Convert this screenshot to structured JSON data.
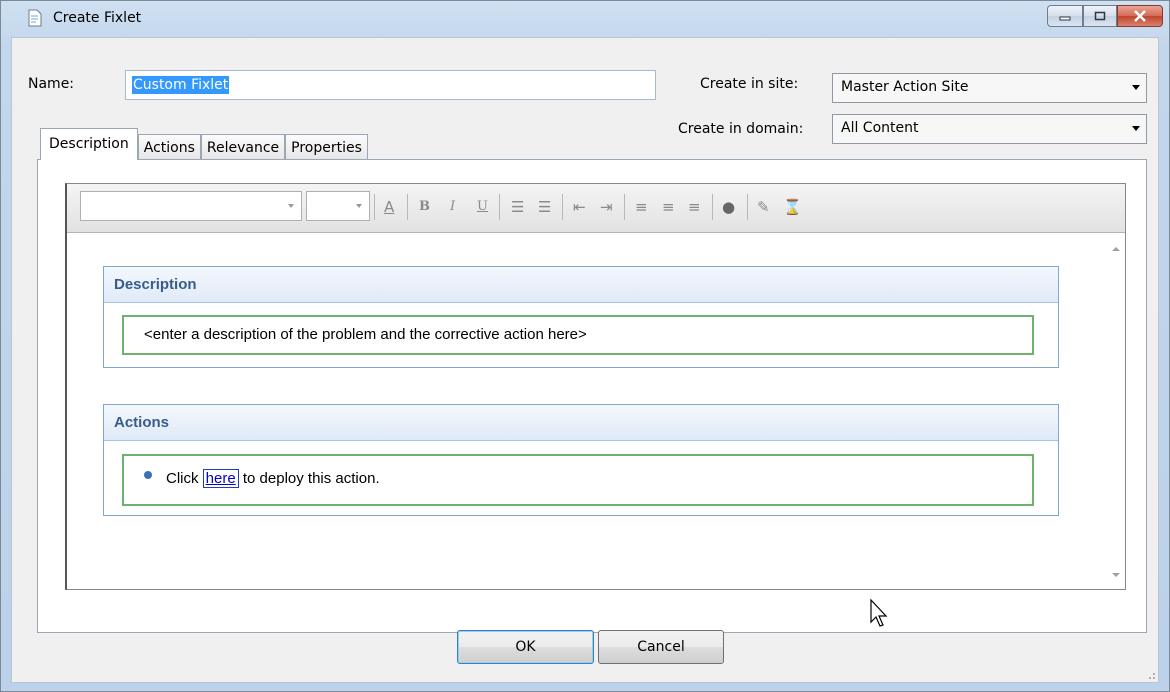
{
  "window": {
    "title": "Create Fixlet"
  },
  "form": {
    "name_label": "Name:",
    "name_value": "Custom Fixlet",
    "site_label": "Create in site:",
    "site_value": "Master Action Site",
    "domain_label": "Create in domain:",
    "domain_value": "All Content"
  },
  "tabs": [
    {
      "label": "Description",
      "active": true
    },
    {
      "label": "Actions",
      "active": false
    },
    {
      "label": "Relevance",
      "active": false
    },
    {
      "label": "Properties",
      "active": false
    }
  ],
  "editor": {
    "toolbar_icons": [
      "font-color-icon",
      "bold-icon",
      "italic-icon",
      "underline-icon",
      "numbered-list-icon",
      "bullet-list-icon",
      "outdent-icon",
      "indent-icon",
      "align-left-icon",
      "align-center-icon",
      "align-right-icon",
      "insert-link-icon",
      "clear-format-icon",
      "source-view-icon"
    ],
    "description_section": {
      "heading": "Description",
      "body": "<enter a description of the problem and the corrective action here>"
    },
    "actions_section": {
      "heading": "Actions",
      "prefix": "Click ",
      "link": "here",
      "suffix": " to deploy this action."
    }
  },
  "buttons": {
    "ok": "OK",
    "cancel": "Cancel"
  }
}
